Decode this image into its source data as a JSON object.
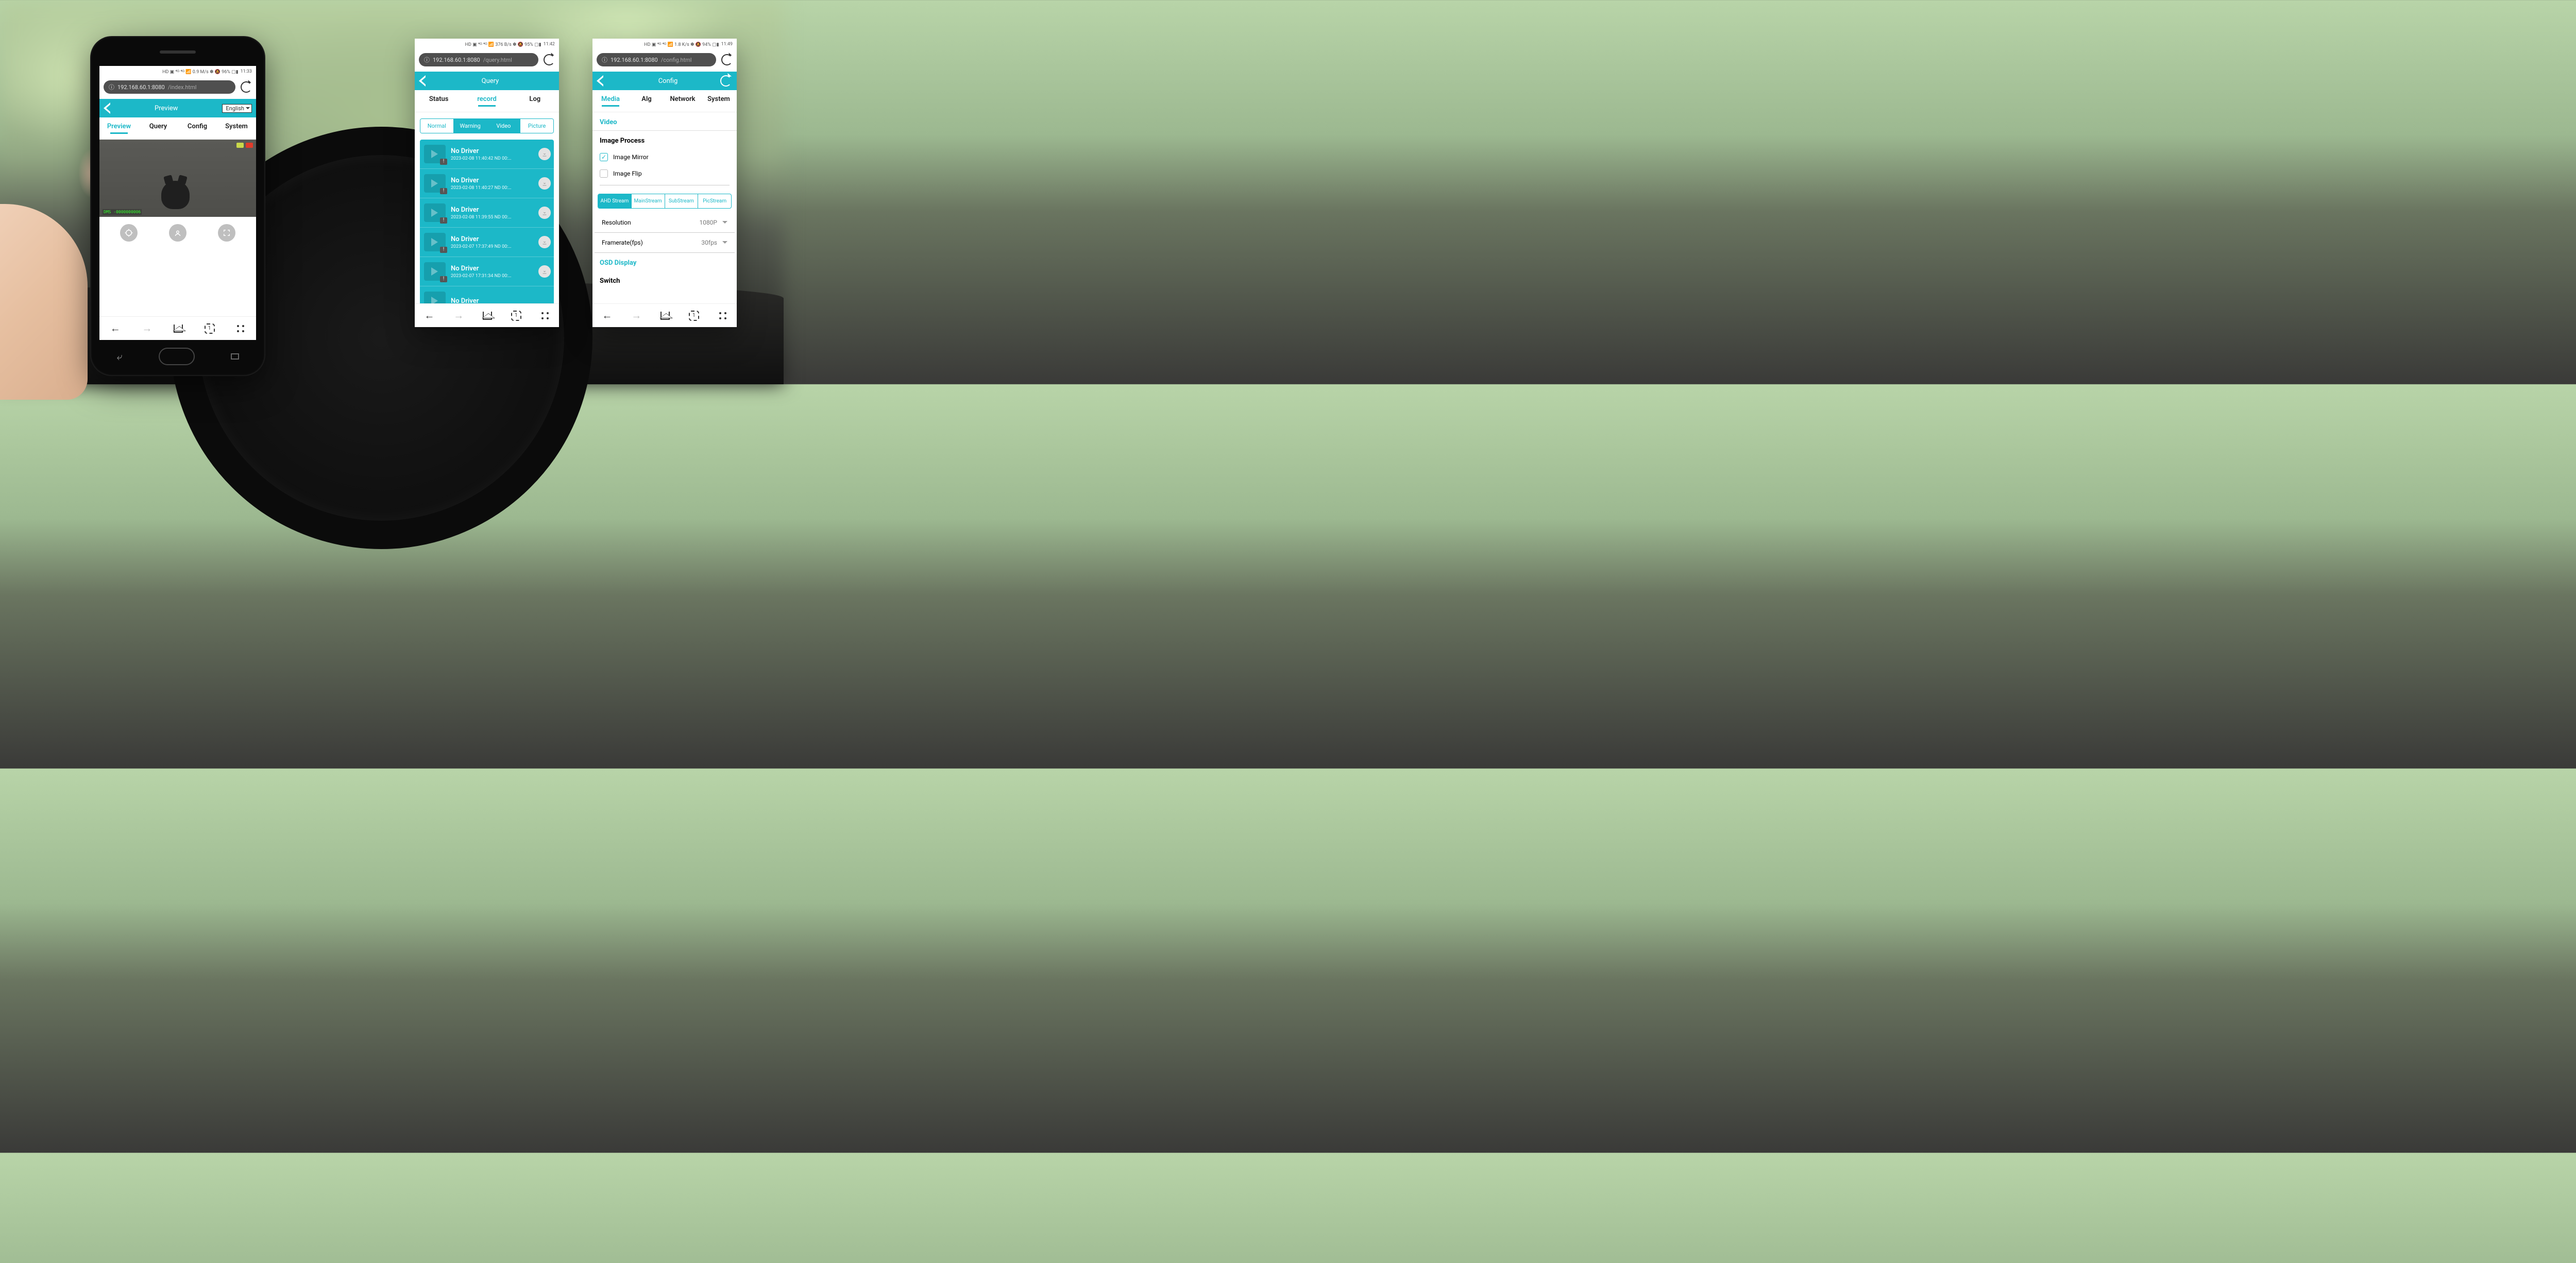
{
  "phones": {
    "preview": {
      "status": {
        "icons": "HD ▣ ⁴ᴳ ⁴ᴳ 📶 0.9 M/s  ✽ 🔕 96% ▢▮",
        "time": "11:33"
      },
      "url_host": "192.168.60.1:8080",
      "url_page": "/index.html",
      "header_title": "Preview",
      "lang": "English",
      "tabs": [
        "Preview",
        "Query",
        "Config",
        "System"
      ],
      "active_tab": 0,
      "video_overlay": "DMS -0000000006",
      "tab_count": "1"
    },
    "query": {
      "status": {
        "icons": "HD ▣ ⁴ᴳ ⁴ᴳ 📶 376 B/s  ✽ 🔕 95% ▢▮",
        "time": "11:42"
      },
      "url_host": "192.168.60.1:8080",
      "url_page": "/query.html",
      "header_title": "Query",
      "tabs": [
        "Status",
        "record",
        "Log"
      ],
      "active_tab": 1,
      "sub_tabs": [
        "Normal",
        "Warning",
        "Video",
        "Picture"
      ],
      "records": [
        {
          "title": "No Driver",
          "sub": "2023-02-08 11:40:42 ND 00:…"
        },
        {
          "title": "No Driver",
          "sub": "2023-02-08 11:40:27 ND 00:…"
        },
        {
          "title": "No Driver",
          "sub": "2023-02-08 11:39:55 ND 00:…"
        },
        {
          "title": "No Driver",
          "sub": "2023-02-07 17:37:49 ND 00:…"
        },
        {
          "title": "No Driver",
          "sub": "2023-02-07 17:31:34 ND 00:…"
        },
        {
          "title": "No Driver",
          "sub": ""
        }
      ],
      "tab_count": "1"
    },
    "config": {
      "status": {
        "icons": "HD ▣ ⁴ᴳ ⁴ᴳ 📶 1.8 K/s  ✽ 🔕 94% ▢▮",
        "time": "11:49"
      },
      "url_host": "192.168.60.1:8080",
      "url_page": "/config.html",
      "header_title": "Config",
      "tabs": [
        "Media",
        "Alg",
        "Network",
        "System"
      ],
      "active_tab": 0,
      "section_video": "Video",
      "group_image_process": "Image Process",
      "check_mirror": "Image Mirror",
      "check_flip": "Image Flip",
      "stream_tabs": [
        "AHD Stream",
        "MainStream",
        "SubStream",
        "PicStream"
      ],
      "resolution_label": "Resolution",
      "resolution_value": "1080P",
      "framerate_label": "Framerate(fps)",
      "framerate_value": "30fps",
      "section_osd": "OSD Display",
      "switch_label": "Switch",
      "tab_count": "1"
    }
  }
}
